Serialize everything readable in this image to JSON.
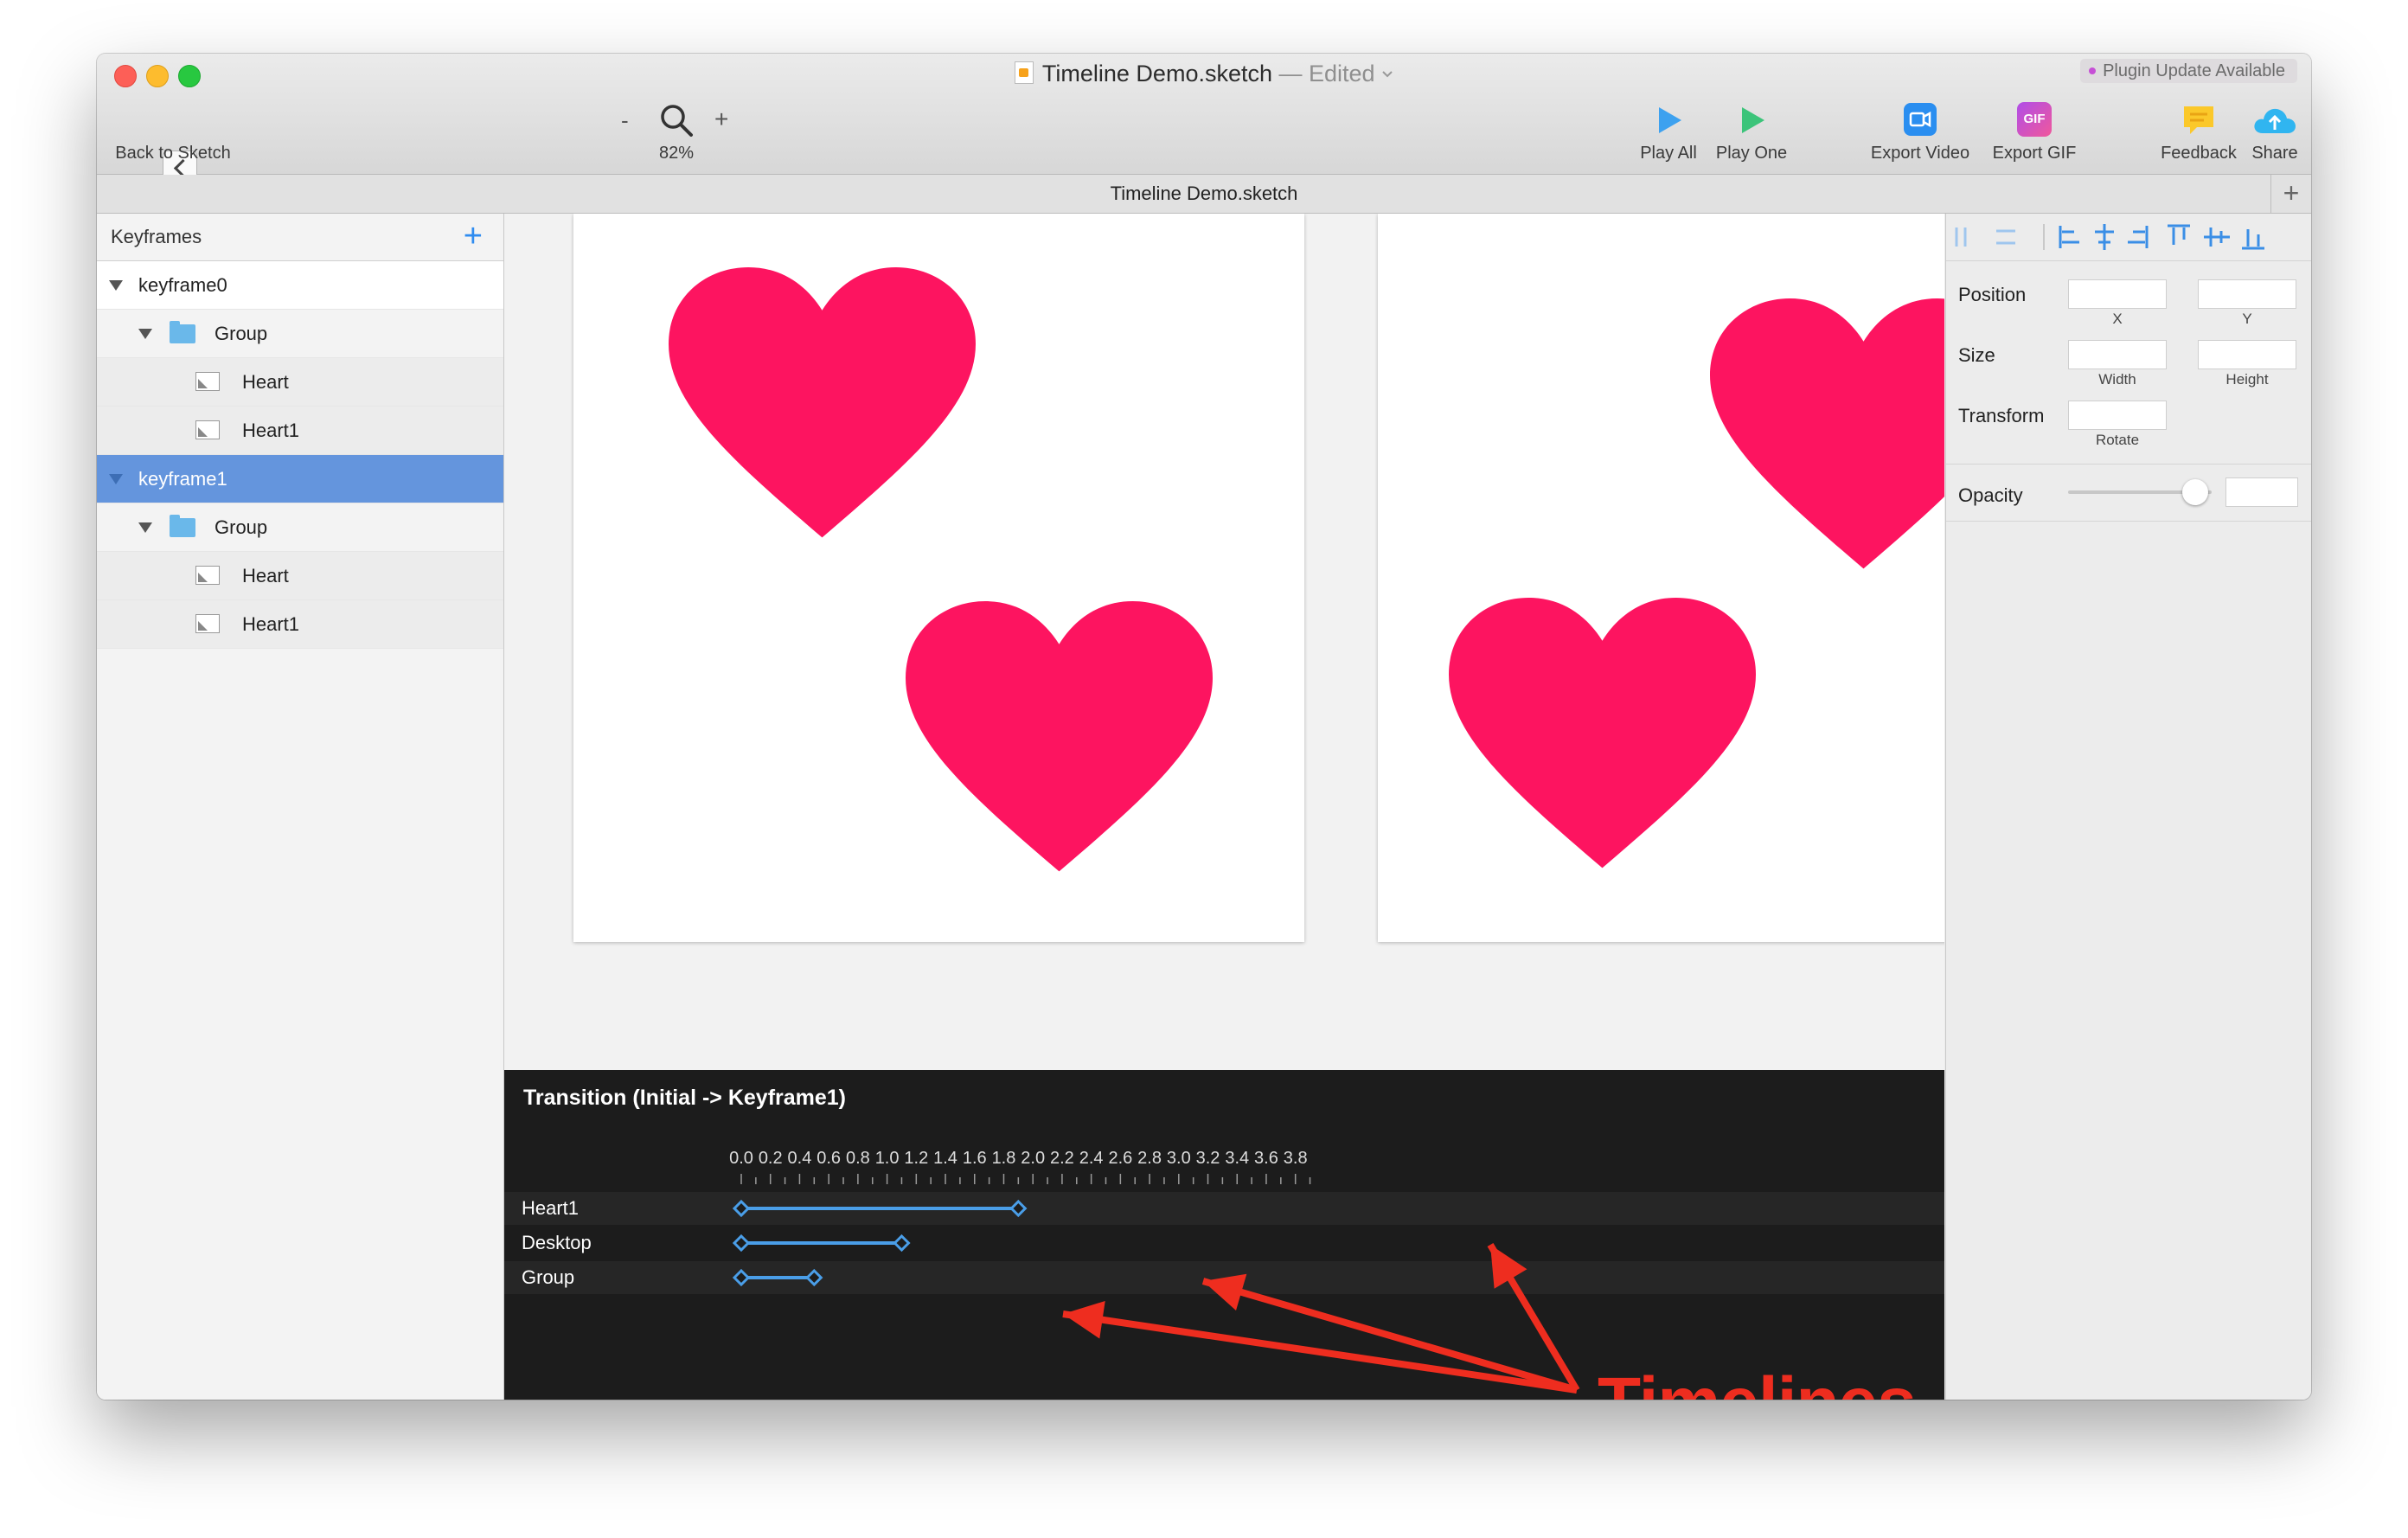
{
  "window": {
    "document_title": "Timeline Demo.sketch",
    "edited_label": "— Edited",
    "plugin_badge": "Plugin Update Available"
  },
  "toolbar": {
    "back_label": "Back to Sketch",
    "zoom_minus": "-",
    "zoom_plus": "+",
    "zoom_level": "82%",
    "play_all": "Play All",
    "play_one": "Play One",
    "export_video": "Export Video",
    "export_gif": "Export GIF",
    "gif_badge": "GIF",
    "feedback": "Feedback",
    "share": "Share"
  },
  "tab": {
    "title": "Timeline Demo.sketch",
    "add": "+"
  },
  "sidebar": {
    "header": "Keyframes",
    "add": "+",
    "rows": [
      {
        "label": "keyframe0",
        "kind": "keyframe"
      },
      {
        "label": "Group",
        "kind": "group"
      },
      {
        "label": "Heart",
        "kind": "layer"
      },
      {
        "label": "Heart1",
        "kind": "layer"
      },
      {
        "label": "keyframe1",
        "kind": "keyframe",
        "selected": true
      },
      {
        "label": "Group",
        "kind": "group"
      },
      {
        "label": "Heart",
        "kind": "layer"
      },
      {
        "label": "Heart1",
        "kind": "layer"
      }
    ]
  },
  "canvas": {
    "heart_color": "#fd1460"
  },
  "timeline": {
    "title": "Transition (Initial -> Keyframe1)",
    "ticks": [
      "0.0",
      "0.2",
      "0.4",
      "0.6",
      "0.8",
      "1.0",
      "1.2",
      "1.4",
      "1.6",
      "1.8",
      "2.0",
      "2.2",
      "2.4",
      "2.6",
      "2.8",
      "3.0",
      "3.2",
      "3.4",
      "3.6",
      "3.8"
    ],
    "tracks": [
      {
        "name": "Heart1",
        "start": 0.0,
        "end": 1.9
      },
      {
        "name": "Desktop",
        "start": 0.0,
        "end": 1.1
      },
      {
        "name": "Group",
        "start": 0.0,
        "end": 0.5
      }
    ],
    "track_color": "#4a9ee8",
    "annotation": "Timelines",
    "annotation_color": "#ee2d1f"
  },
  "inspector": {
    "position": "Position",
    "x": "X",
    "y": "Y",
    "size": "Size",
    "width": "Width",
    "height": "Height",
    "transform": "Transform",
    "rotate": "Rotate",
    "opacity": "Opacity",
    "opacity_level": 0.97
  }
}
